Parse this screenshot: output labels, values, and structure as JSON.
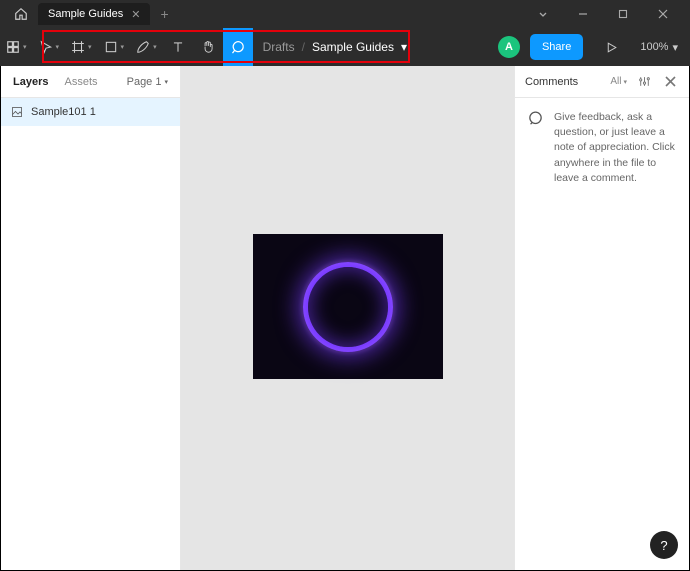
{
  "titlebar": {
    "tab_title": "Sample Guides"
  },
  "toolbar": {
    "breadcrumb_root": "Drafts",
    "breadcrumb_current": "Sample Guides",
    "avatar_initial": "A",
    "share_label": "Share",
    "zoom": "100%"
  },
  "left": {
    "tabs": {
      "layers": "Layers",
      "assets": "Assets"
    },
    "page_label": "Page 1",
    "layers": [
      {
        "name": "Sample101 1"
      }
    ]
  },
  "right": {
    "title": "Comments",
    "filter": "All",
    "hint": "Give feedback, ask a question, or just leave a note of appreciation. Click anywhere in the file to leave a comment."
  },
  "help": "?"
}
